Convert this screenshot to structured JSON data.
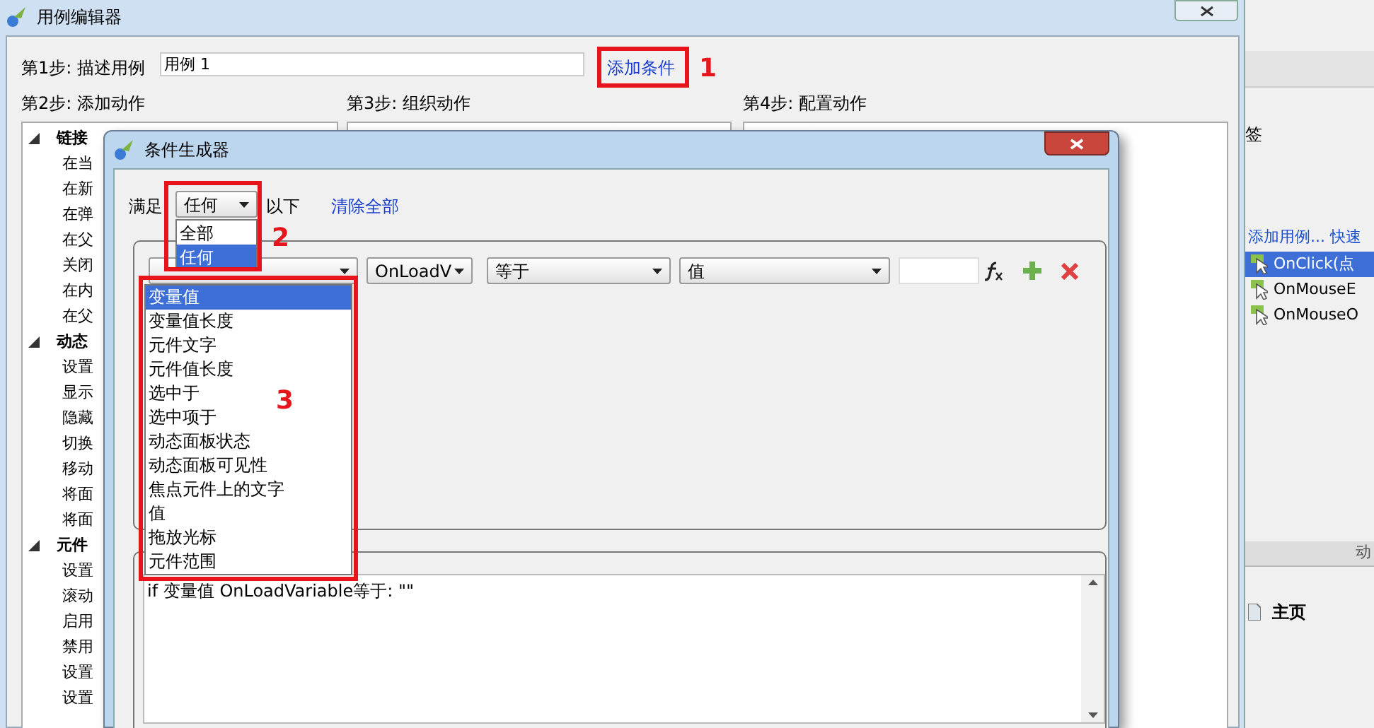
{
  "editor": {
    "title": "用例编辑器",
    "step1_label": "第1步: 描述用例",
    "case_name": "用例 1",
    "add_condition_link": "添加条件",
    "step2_label": "第2步: 添加动作",
    "step3_label": "第3步: 组织动作",
    "step4_label": "第4步: 配置动作",
    "action_tree": [
      {
        "label": "链接",
        "expanded": true,
        "children": [
          {
            "label": "在当"
          },
          {
            "label": "在新"
          },
          {
            "label": "在弹"
          },
          {
            "label": "在父"
          },
          {
            "label": "关闭"
          },
          {
            "label": "在内"
          },
          {
            "label": "在父"
          }
        ]
      },
      {
        "label": "动态",
        "expanded": true,
        "children": [
          {
            "label": "设置"
          },
          {
            "label": "显示"
          },
          {
            "label": "隐藏"
          },
          {
            "label": "切换"
          },
          {
            "label": "移动"
          },
          {
            "label": "将面"
          },
          {
            "label": "将面"
          }
        ]
      },
      {
        "label": "元件",
        "expanded": true,
        "children": [
          {
            "label": "设置"
          },
          {
            "label": "滚动"
          },
          {
            "label": "启用"
          },
          {
            "label": "禁用"
          },
          {
            "label": "设置"
          },
          {
            "label": "设置"
          }
        ]
      }
    ]
  },
  "background_panel": {
    "label": "签",
    "links": "添加用例... 快速",
    "events": [
      {
        "label": "OnClick(点",
        "selected": true
      },
      {
        "label": "OnMouseE",
        "selected": false
      },
      {
        "label": "OnMouseO",
        "selected": false
      }
    ],
    "lower_header": "动",
    "pages": [
      {
        "label": "主页"
      }
    ]
  },
  "dialog": {
    "title": "条件生成器",
    "match_label": "满足",
    "match_value": "任何",
    "match_options": [
      {
        "label": "全部",
        "selected": false
      },
      {
        "label": "任何",
        "selected": true
      }
    ],
    "match_suffix": "以下",
    "clear_all_link": "清除全部",
    "condition": {
      "operand2": "OnLoadV",
      "operator": "等于",
      "value_type": "值"
    },
    "type_options": [
      {
        "label": "变量值",
        "selected": true
      },
      {
        "label": "变量值长度",
        "selected": false
      },
      {
        "label": "元件文字",
        "selected": false
      },
      {
        "label": "元件值长度",
        "selected": false
      },
      {
        "label": "选中于",
        "selected": false
      },
      {
        "label": "选中项于",
        "selected": false
      },
      {
        "label": "动态面板状态",
        "selected": false
      },
      {
        "label": "动态面板可见性",
        "selected": false
      },
      {
        "label": "焦点元件上的文字",
        "selected": false
      },
      {
        "label": "值",
        "selected": false
      },
      {
        "label": "拖放光标",
        "selected": false
      },
      {
        "label": "元件范围",
        "selected": false
      }
    ],
    "description": "if 变量值 OnLoadVariable等于: \"\""
  },
  "annotations": [
    "1",
    "2",
    "3"
  ]
}
